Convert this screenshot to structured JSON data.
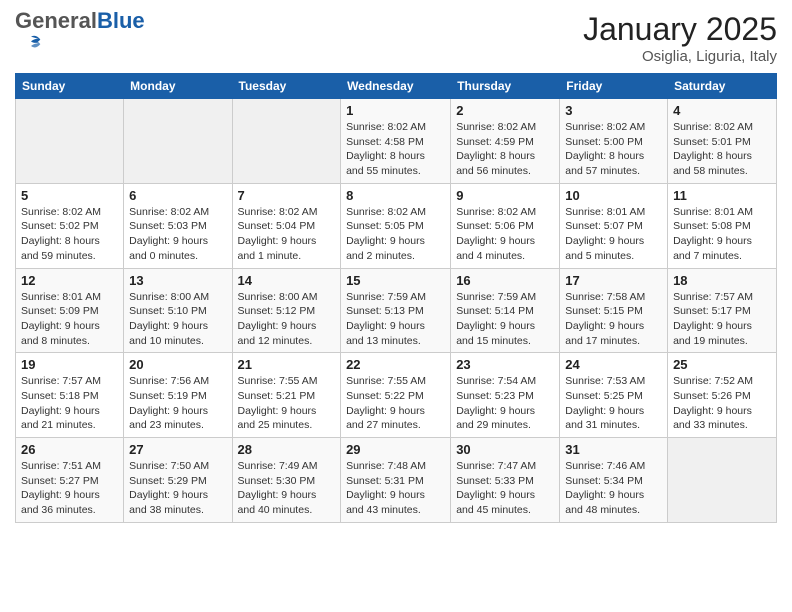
{
  "header": {
    "logo_general": "General",
    "logo_blue": "Blue",
    "title": "January 2025",
    "subtitle": "Osiglia, Liguria, Italy"
  },
  "weekdays": [
    "Sunday",
    "Monday",
    "Tuesday",
    "Wednesday",
    "Thursday",
    "Friday",
    "Saturday"
  ],
  "weeks": [
    [
      {
        "day": "",
        "info": ""
      },
      {
        "day": "",
        "info": ""
      },
      {
        "day": "",
        "info": ""
      },
      {
        "day": "1",
        "info": "Sunrise: 8:02 AM\nSunset: 4:58 PM\nDaylight: 8 hours\nand 55 minutes."
      },
      {
        "day": "2",
        "info": "Sunrise: 8:02 AM\nSunset: 4:59 PM\nDaylight: 8 hours\nand 56 minutes."
      },
      {
        "day": "3",
        "info": "Sunrise: 8:02 AM\nSunset: 5:00 PM\nDaylight: 8 hours\nand 57 minutes."
      },
      {
        "day": "4",
        "info": "Sunrise: 8:02 AM\nSunset: 5:01 PM\nDaylight: 8 hours\nand 58 minutes."
      }
    ],
    [
      {
        "day": "5",
        "info": "Sunrise: 8:02 AM\nSunset: 5:02 PM\nDaylight: 8 hours\nand 59 minutes."
      },
      {
        "day": "6",
        "info": "Sunrise: 8:02 AM\nSunset: 5:03 PM\nDaylight: 9 hours\nand 0 minutes."
      },
      {
        "day": "7",
        "info": "Sunrise: 8:02 AM\nSunset: 5:04 PM\nDaylight: 9 hours\nand 1 minute."
      },
      {
        "day": "8",
        "info": "Sunrise: 8:02 AM\nSunset: 5:05 PM\nDaylight: 9 hours\nand 2 minutes."
      },
      {
        "day": "9",
        "info": "Sunrise: 8:02 AM\nSunset: 5:06 PM\nDaylight: 9 hours\nand 4 minutes."
      },
      {
        "day": "10",
        "info": "Sunrise: 8:01 AM\nSunset: 5:07 PM\nDaylight: 9 hours\nand 5 minutes."
      },
      {
        "day": "11",
        "info": "Sunrise: 8:01 AM\nSunset: 5:08 PM\nDaylight: 9 hours\nand 7 minutes."
      }
    ],
    [
      {
        "day": "12",
        "info": "Sunrise: 8:01 AM\nSunset: 5:09 PM\nDaylight: 9 hours\nand 8 minutes."
      },
      {
        "day": "13",
        "info": "Sunrise: 8:00 AM\nSunset: 5:10 PM\nDaylight: 9 hours\nand 10 minutes."
      },
      {
        "day": "14",
        "info": "Sunrise: 8:00 AM\nSunset: 5:12 PM\nDaylight: 9 hours\nand 12 minutes."
      },
      {
        "day": "15",
        "info": "Sunrise: 7:59 AM\nSunset: 5:13 PM\nDaylight: 9 hours\nand 13 minutes."
      },
      {
        "day": "16",
        "info": "Sunrise: 7:59 AM\nSunset: 5:14 PM\nDaylight: 9 hours\nand 15 minutes."
      },
      {
        "day": "17",
        "info": "Sunrise: 7:58 AM\nSunset: 5:15 PM\nDaylight: 9 hours\nand 17 minutes."
      },
      {
        "day": "18",
        "info": "Sunrise: 7:57 AM\nSunset: 5:17 PM\nDaylight: 9 hours\nand 19 minutes."
      }
    ],
    [
      {
        "day": "19",
        "info": "Sunrise: 7:57 AM\nSunset: 5:18 PM\nDaylight: 9 hours\nand 21 minutes."
      },
      {
        "day": "20",
        "info": "Sunrise: 7:56 AM\nSunset: 5:19 PM\nDaylight: 9 hours\nand 23 minutes."
      },
      {
        "day": "21",
        "info": "Sunrise: 7:55 AM\nSunset: 5:21 PM\nDaylight: 9 hours\nand 25 minutes."
      },
      {
        "day": "22",
        "info": "Sunrise: 7:55 AM\nSunset: 5:22 PM\nDaylight: 9 hours\nand 27 minutes."
      },
      {
        "day": "23",
        "info": "Sunrise: 7:54 AM\nSunset: 5:23 PM\nDaylight: 9 hours\nand 29 minutes."
      },
      {
        "day": "24",
        "info": "Sunrise: 7:53 AM\nSunset: 5:25 PM\nDaylight: 9 hours\nand 31 minutes."
      },
      {
        "day": "25",
        "info": "Sunrise: 7:52 AM\nSunset: 5:26 PM\nDaylight: 9 hours\nand 33 minutes."
      }
    ],
    [
      {
        "day": "26",
        "info": "Sunrise: 7:51 AM\nSunset: 5:27 PM\nDaylight: 9 hours\nand 36 minutes."
      },
      {
        "day": "27",
        "info": "Sunrise: 7:50 AM\nSunset: 5:29 PM\nDaylight: 9 hours\nand 38 minutes."
      },
      {
        "day": "28",
        "info": "Sunrise: 7:49 AM\nSunset: 5:30 PM\nDaylight: 9 hours\nand 40 minutes."
      },
      {
        "day": "29",
        "info": "Sunrise: 7:48 AM\nSunset: 5:31 PM\nDaylight: 9 hours\nand 43 minutes."
      },
      {
        "day": "30",
        "info": "Sunrise: 7:47 AM\nSunset: 5:33 PM\nDaylight: 9 hours\nand 45 minutes."
      },
      {
        "day": "31",
        "info": "Sunrise: 7:46 AM\nSunset: 5:34 PM\nDaylight: 9 hours\nand 48 minutes."
      },
      {
        "day": "",
        "info": ""
      }
    ]
  ]
}
